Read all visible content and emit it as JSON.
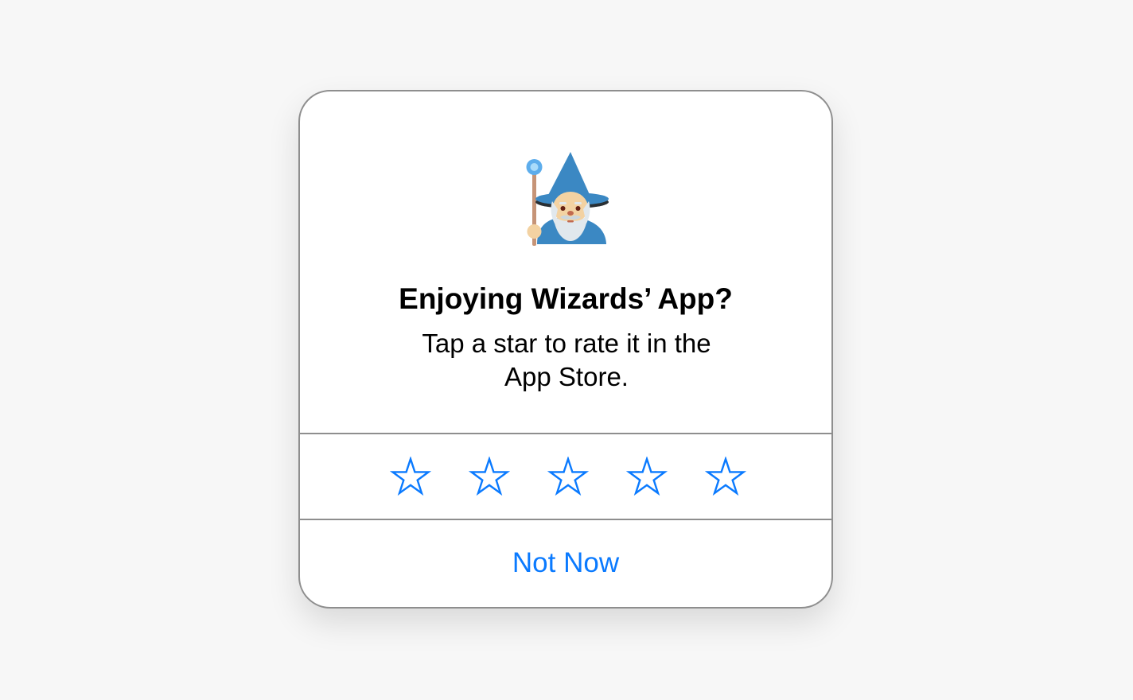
{
  "dialog": {
    "title": "Enjoying Wizards’ App?",
    "message_line1": "Tap a star to rate it in the",
    "message_line2": "App Store.",
    "app_icon": "mage-emoji",
    "rating": {
      "max_stars": 5,
      "selected": 0,
      "star_icon": "star-outline-icon",
      "star_color": "#0a7aff"
    },
    "not_now_label": "Not Now",
    "accent_color": "#0a7aff"
  }
}
